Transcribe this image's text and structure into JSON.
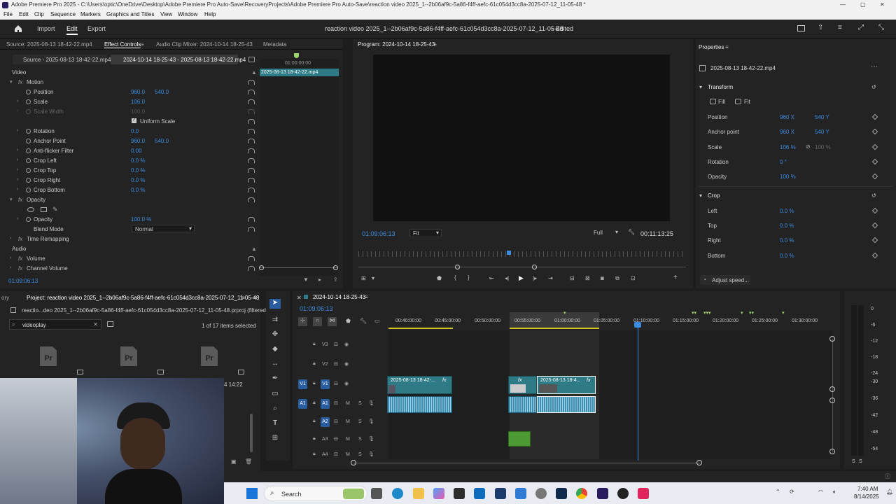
{
  "window": {
    "title": "Adobe Premiere Pro 2025 - C:\\Users\\optic\\OneDrive\\Desktop\\Adobe Premiere Pro Auto-Save\\RecoveryProjects\\Adobe Premiere Pro Auto-Save\\reaction video 2025_1--2b06af9c-5a86-f4ff-aefc-61c054d3cc8a-2025-07-12_11-05-48 *"
  },
  "menu": [
    "File",
    "Edit",
    "Clip",
    "Sequence",
    "Markers",
    "Graphics and Titles",
    "View",
    "Window",
    "Help"
  ],
  "header": {
    "home": "home-icon",
    "import": "Import",
    "edit": "Edit",
    "export": "Export",
    "doc_title": "reaction video 2025_1--2b06af9c-5a86-f4ff-aefc-61c054d3cc8a-2025-07-12_11-05-48",
    "doc_status": "- Edited"
  },
  "source_tabs": {
    "source": "Source: 2025-08-13 18-42-22.mp4",
    "effect_controls": "Effect Controls",
    "audio_mixer": "Audio Clip Mixer: 2024-10-14 18-25-43",
    "metadata": "Metadata"
  },
  "ec": {
    "subtab_source": "Source - 2025-08-13 18-42-22.mp4",
    "subtab_seq": "2024-10-14 18-25-43 - 2025-08-13 18-42-22.mp4",
    "mini_time": "01:00:00:00",
    "mini_clip": "2025-08-13 18-42-22.mp4",
    "video": "Video",
    "motion": "Motion",
    "position": "Position",
    "pos_x": "960.0",
    "pos_y": "540.0",
    "scale": "Scale",
    "scale_v": "106.0",
    "scale_width": "Scale Width",
    "scale_width_v": "100.0",
    "uniform": "Uniform Scale",
    "rotation": "Rotation",
    "rotation_v": "0.0",
    "anchor": "Anchor Point",
    "anchor_x": "960.0",
    "anchor_y": "540.0",
    "flicker": "Anti-flicker Filter",
    "flicker_v": "0.00",
    "crop_left": "Crop Left",
    "crop_left_v": "0.0 %",
    "crop_top": "Crop Top",
    "crop_top_v": "0.0 %",
    "crop_right": "Crop Right",
    "crop_right_v": "0.0 %",
    "crop_bottom": "Crop Bottom",
    "crop_bottom_v": "0.0 %",
    "opacity_grp": "Opacity",
    "opacity": "Opacity",
    "opacity_v": "100.0 %",
    "blend": "Blend Mode",
    "blend_v": "Normal",
    "time_remap": "Time Remapping",
    "audio": "Audio",
    "volume": "Volume",
    "channel_volume": "Channel Volume",
    "timecode": "01:09:06:13"
  },
  "program": {
    "title": "Program: 2024-10-14 18-25-43",
    "timecode": "01:09:06:13",
    "fit": "Fit",
    "quality": "Full",
    "duration": "00:11:13:25"
  },
  "properties": {
    "title": "Properties",
    "clip": "2025-08-13 18-42-22.mp4",
    "transform": "Transform",
    "fill": "Fill",
    "fit": "Fit",
    "position": "Position",
    "pos_x": "960 X",
    "pos_y": "540 Y",
    "anchor": "Anchor point",
    "anchor_x": "960 X",
    "anchor_y": "540 Y",
    "scale": "Scale",
    "scale_v": "106 %",
    "scale_w": "100 %",
    "rotation": "Rotation",
    "rotation_v": "0 °",
    "opacity": "Opacity",
    "opacity_v": "100 %",
    "crop": "Crop",
    "left": "Left",
    "left_v": "0.0 %",
    "top": "Top",
    "top_v": "0.0 %",
    "right": "Right",
    "right_v": "0.0 %",
    "bottom": "Bottom",
    "bottom_v": "0.0 %",
    "adjust_speed": "Adjust speed..."
  },
  "project": {
    "tab_prev": "ory",
    "tab": "Project: reaction video 2025_1--2b06af9c-5a86-f4ff-aefc-61c054d3cc8a-2025-07-12_11-05-48",
    "file": "reactio...deo 2025_1--2b06af9c-5a86-f4ff-aefc-61c054d3cc8a-2025-07-12_11-05-48.prproj (filtered)",
    "search": "videoplay",
    "selected": "1 of 17 items selected",
    "thumb_time": "4 14:22"
  },
  "timeline": {
    "seq": "2024-10-14 18-25-43",
    "timecode": "01:09:06:13",
    "ruler": [
      "00:40:00:00",
      "00:45:00:00",
      "00:50:00:00",
      "00:55:00:00",
      "01:00:00:00",
      "01:05:00:00",
      "01:10:00:00",
      "01:15:00:00",
      "01:20:00:00",
      "01:25:00:00",
      "01:30:00:00"
    ],
    "clip1": "2025-08-13 18-42-...",
    "clip2": "2025-08-13 18-4...",
    "fx": "fx",
    "tracks": {
      "v3": "V3",
      "v2": "V2",
      "v1": "V1",
      "a1": "A1",
      "a2": "A2",
      "a3": "A3",
      "a4": "A4",
      "m": "M",
      "s": "S"
    }
  },
  "meter": {
    "ticks": [
      "0",
      "-6",
      "-12",
      "-18",
      "-24",
      "-30",
      "-36",
      "-42",
      "-48",
      "-54"
    ],
    "s1": "S",
    "s2": "S"
  },
  "taskbar": {
    "search": "Search",
    "time": "7:40 AM",
    "date": "8/14/2025"
  }
}
